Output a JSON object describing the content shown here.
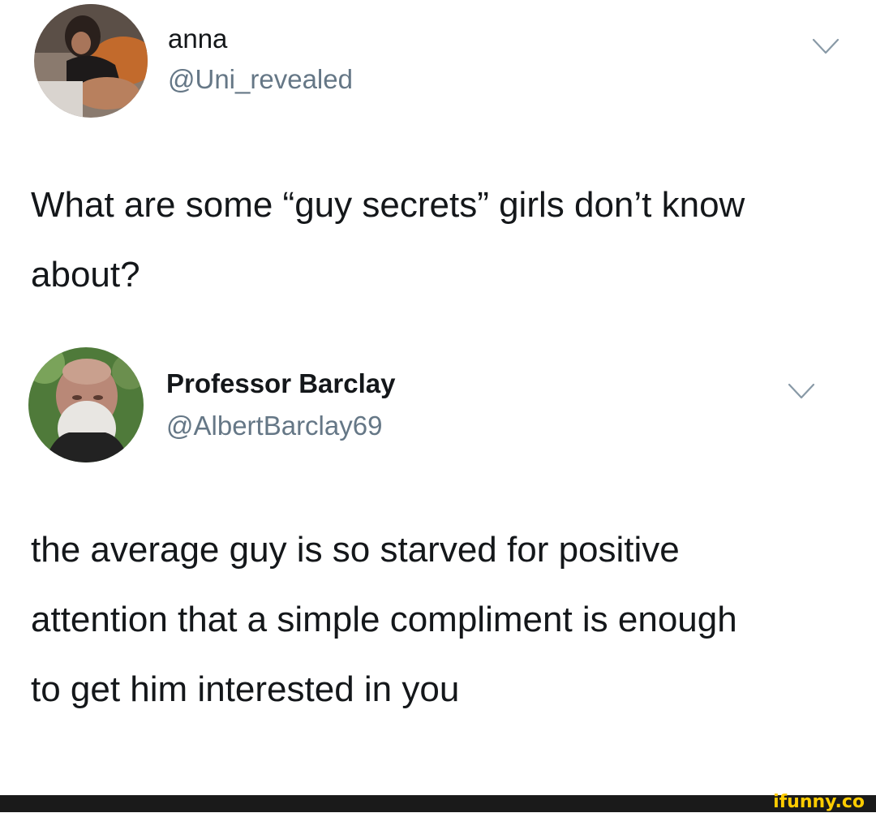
{
  "tweets": [
    {
      "author": {
        "display_name": "anna",
        "handle": "@Uni_revealed",
        "avatar_icon": "user-avatar-photo"
      },
      "menu_icon": "chevron-down-icon",
      "text": "What are some “guy secrets” girls don’t know about?"
    },
    {
      "author": {
        "display_name": "Professor Barclay",
        "handle": "@AlbertBarclay69",
        "avatar_icon": "user-avatar-photo"
      },
      "menu_icon": "chevron-down-icon",
      "text": "the average guy is so starved for positive attention that a simple compliment is enough to get him interested in you"
    }
  ],
  "footer": {
    "watermark": "ifunny.co",
    "watermark_color": "#ffcc00",
    "bar_color": "#1a1a1a"
  },
  "colors": {
    "text_primary": "#14171a",
    "text_secondary": "#657786",
    "chevron": "#8899a6"
  }
}
